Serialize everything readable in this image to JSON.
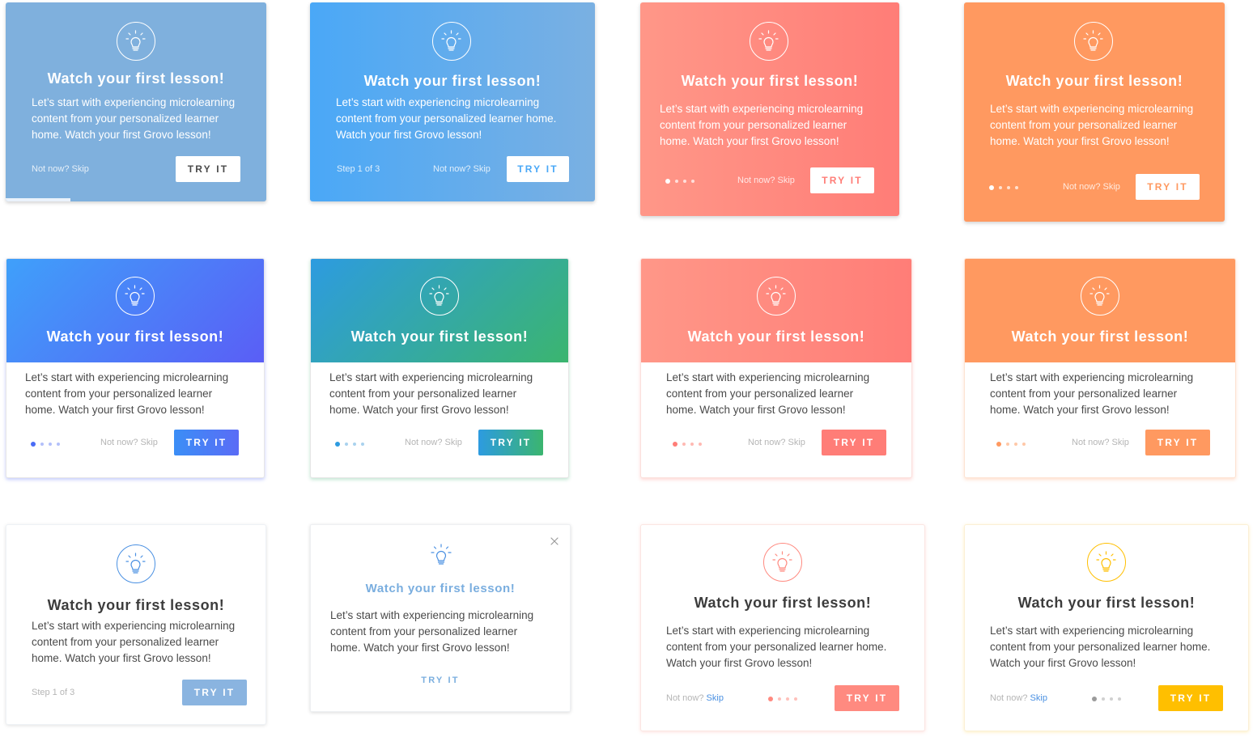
{
  "cards": {
    "title": "Watch your first lesson!",
    "body_short": "Let’s start with experiencing microlearning content from your personalized learner home. Watch your first Grovo lesson!",
    "skip_text": "Not now? Skip",
    "skip_prefix": "Not now?",
    "skip_link": "Skip",
    "try_label": "TRY IT",
    "step_label": "Step 1 of 3",
    "icon": "lightbulb-icon",
    "close_icon": "close-icon"
  },
  "colors": {
    "blue_muted": "#7fb0dd",
    "blue_bright": "#4aa8f7",
    "coral": "#ff8577",
    "orange": "#ff9960",
    "blue_violet": "#5a6cf6",
    "teal_green": "#3bb274",
    "steel_blue": "#8ab4e0",
    "coral_button": "#ff8a80",
    "amber": "#ffbf00"
  }
}
